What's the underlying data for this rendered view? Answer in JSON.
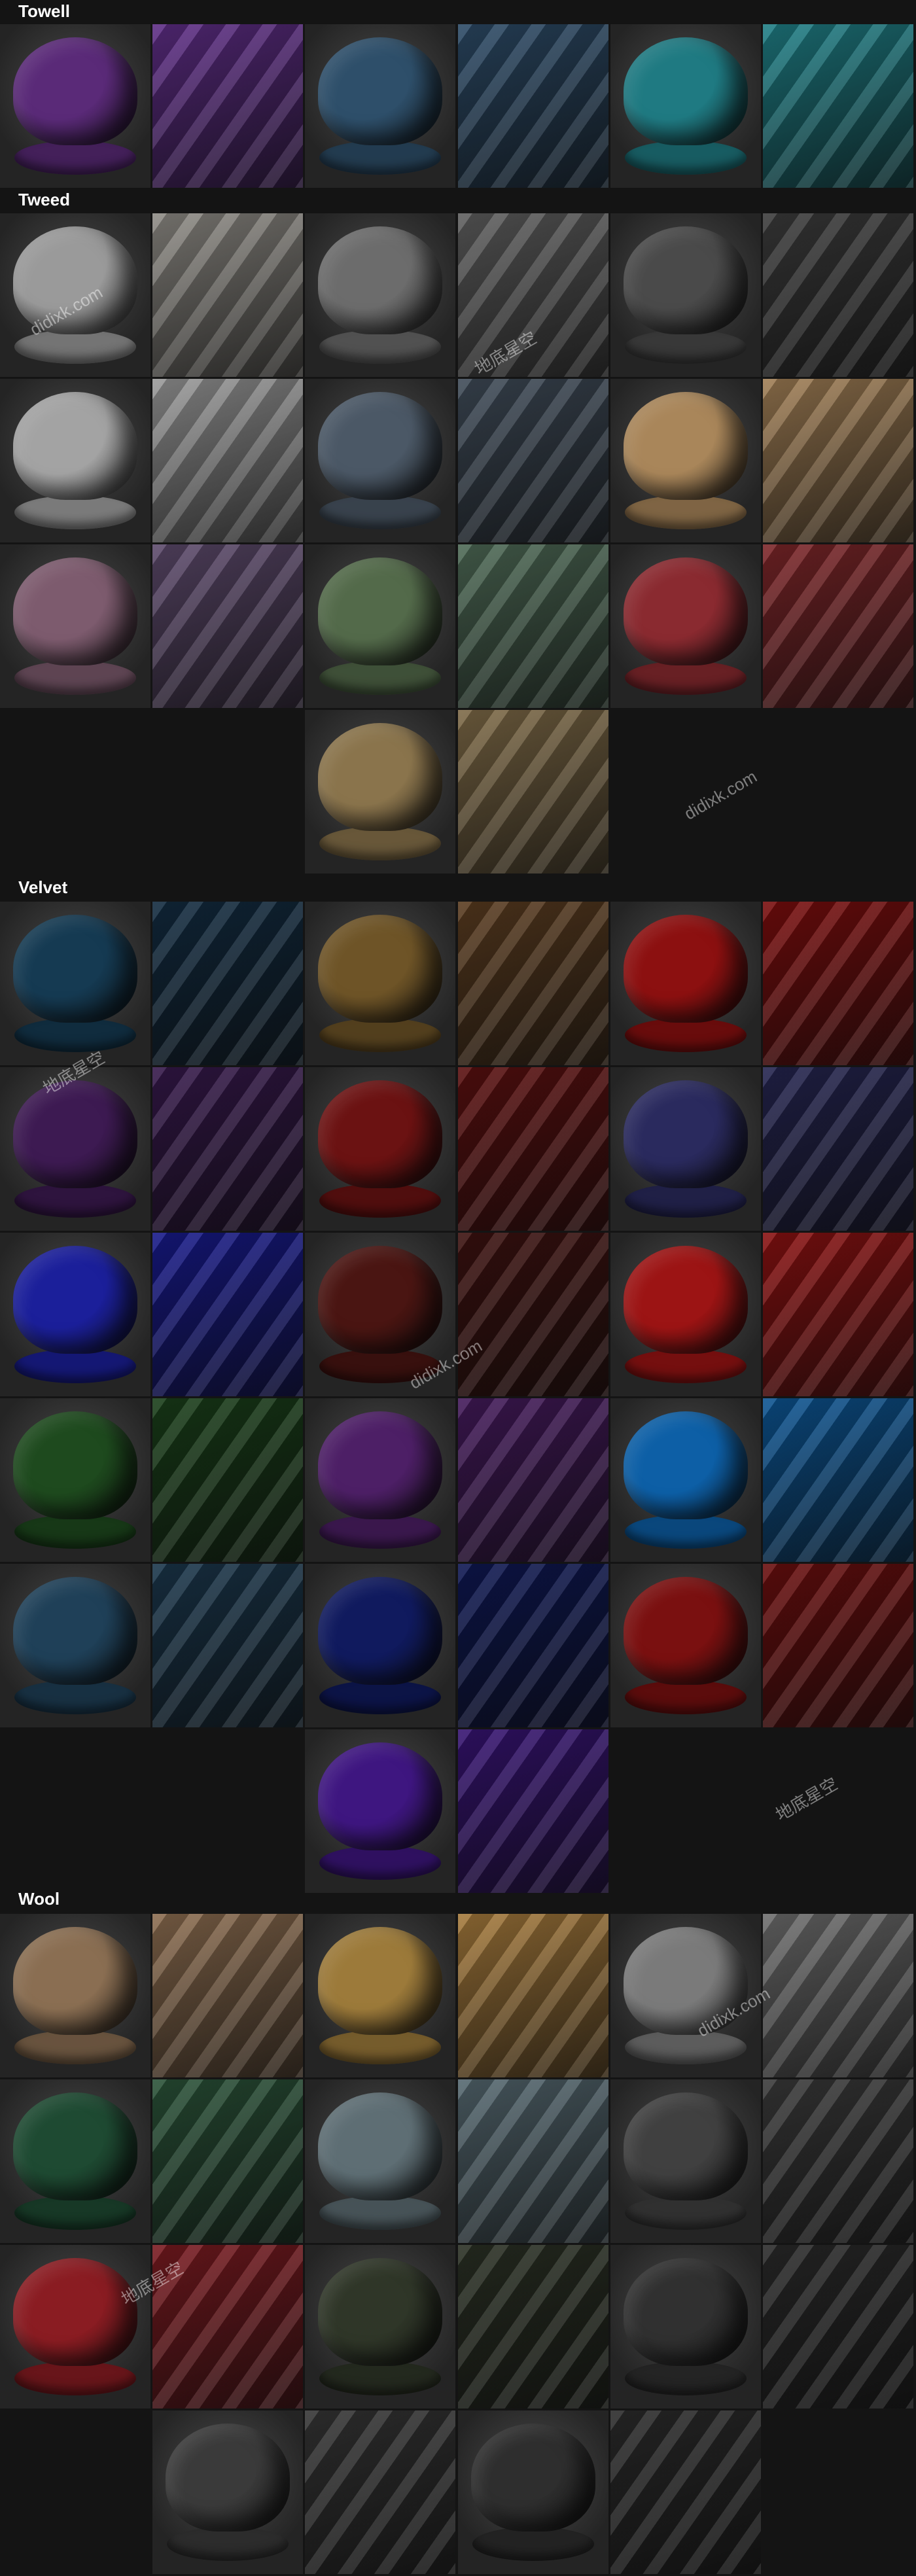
{
  "sections": [
    {
      "title": "Towell",
      "tiles": [
        {
          "kind": "sphere",
          "color": "#5a2a78"
        },
        {
          "kind": "swatch",
          "color": "#5e2d86"
        },
        {
          "kind": "sphere",
          "color": "#2e4f6a"
        },
        {
          "kind": "swatch",
          "color": "#2c4a66"
        },
        {
          "kind": "sphere",
          "color": "#1f7a82"
        },
        {
          "kind": "swatch",
          "color": "#1f7f86"
        }
      ]
    },
    {
      "title": "Tweed",
      "tiles": [
        {
          "kind": "sphere",
          "color": "#9a9a9a"
        },
        {
          "kind": "swatch",
          "color": "#8f8c86"
        },
        {
          "kind": "sphere",
          "color": "#6c6c6c"
        },
        {
          "kind": "swatch",
          "color": "#5f5f5f"
        },
        {
          "kind": "sphere",
          "color": "#4a4a4a"
        },
        {
          "kind": "swatch",
          "color": "#3c3c3c"
        },
        {
          "kind": "sphere",
          "color": "#a3a3a3"
        },
        {
          "kind": "swatch",
          "color": "#9a9a9a"
        },
        {
          "kind": "sphere",
          "color": "#4b5866"
        },
        {
          "kind": "swatch",
          "color": "#3f4b58"
        },
        {
          "kind": "sphere",
          "color": "#a9865a"
        },
        {
          "kind": "swatch",
          "color": "#a07e55"
        },
        {
          "kind": "sphere",
          "color": "#7d5b6e"
        },
        {
          "kind": "swatch",
          "color": "#5d4a6c"
        },
        {
          "kind": "sphere",
          "color": "#536a4a"
        },
        {
          "kind": "swatch",
          "color": "#4e6a56"
        },
        {
          "kind": "sphere",
          "color": "#8a2a30"
        },
        {
          "kind": "swatch",
          "color": "#7d2629"
        },
        {
          "kind": "sphere",
          "color": "#8a744c"
        },
        {
          "kind": "swatch",
          "color": "#7e6a47"
        }
      ]
    },
    {
      "title": "Velvet",
      "tiles": [
        {
          "kind": "sphere",
          "color": "#153a52"
        },
        {
          "kind": "swatch",
          "color": "#122b40"
        },
        {
          "kind": "sphere",
          "color": "#6e5427"
        },
        {
          "kind": "swatch",
          "color": "#5a3c20"
        },
        {
          "kind": "sphere",
          "color": "#8c1010"
        },
        {
          "kind": "swatch",
          "color": "#7a0d0d"
        },
        {
          "kind": "sphere",
          "color": "#3d1a52"
        },
        {
          "kind": "swatch",
          "color": "#35184a"
        },
        {
          "kind": "sphere",
          "color": "#6b1212"
        },
        {
          "kind": "swatch",
          "color": "#5a0f0f"
        },
        {
          "kind": "sphere",
          "color": "#2a2a5e"
        },
        {
          "kind": "swatch",
          "color": "#24244f"
        },
        {
          "kind": "sphere",
          "color": "#1b1f9a"
        },
        {
          "kind": "swatch",
          "color": "#17198a"
        },
        {
          "kind": "sphere",
          "color": "#4a1512"
        },
        {
          "kind": "swatch",
          "color": "#3c110f"
        },
        {
          "kind": "sphere",
          "color": "#9c1414"
        },
        {
          "kind": "swatch",
          "color": "#8a1111"
        },
        {
          "kind": "sphere",
          "color": "#1e4a1e"
        },
        {
          "kind": "swatch",
          "color": "#193e19"
        },
        {
          "kind": "sphere",
          "color": "#4d1f66"
        },
        {
          "kind": "swatch",
          "color": "#43195a"
        },
        {
          "kind": "sphere",
          "color": "#0d5fa6"
        },
        {
          "kind": "swatch",
          "color": "#0c5492"
        },
        {
          "kind": "sphere",
          "color": "#1f4058"
        },
        {
          "kind": "swatch",
          "color": "#1a364b"
        },
        {
          "kind": "sphere",
          "color": "#101a5e"
        },
        {
          "kind": "swatch",
          "color": "#0e1752"
        },
        {
          "kind": "sphere",
          "color": "#7a1010"
        },
        {
          "kind": "swatch",
          "color": "#6a0e0e"
        },
        {
          "kind": "sphere",
          "color": "#3e1680"
        },
        {
          "kind": "swatch",
          "color": "#361372"
        }
      ]
    },
    {
      "title": "Wool",
      "tiles": [
        {
          "kind": "sphere",
          "color": "#8a6e52"
        },
        {
          "kind": "swatch",
          "color": "#8c6d50"
        },
        {
          "kind": "sphere",
          "color": "#9c7a3a"
        },
        {
          "kind": "swatch",
          "color": "#a57a3c"
        },
        {
          "kind": "sphere",
          "color": "#7a7a7a"
        },
        {
          "kind": "swatch",
          "color": "#6e6e6e"
        },
        {
          "kind": "sphere",
          "color": "#1e4a32"
        },
        {
          "kind": "swatch",
          "color": "#2a5238"
        },
        {
          "kind": "sphere",
          "color": "#5e6e74"
        },
        {
          "kind": "swatch",
          "color": "#556870"
        },
        {
          "kind": "sphere",
          "color": "#404040"
        },
        {
          "kind": "swatch",
          "color": "#3a3a3a"
        },
        {
          "kind": "sphere",
          "color": "#8a1c22"
        },
        {
          "kind": "swatch",
          "color": "#7a1a20"
        },
        {
          "kind": "sphere",
          "color": "#2f3628"
        },
        {
          "kind": "swatch",
          "color": "#2a3024"
        },
        {
          "kind": "sphere",
          "color": "#303030"
        },
        {
          "kind": "swatch",
          "color": "#2a2a2a"
        },
        {
          "kind": "sphere",
          "color": "#3a3a3a"
        },
        {
          "kind": "swatch",
          "color": "#353535"
        },
        {
          "kind": "sphere",
          "color": "#2e2e2e"
        },
        {
          "kind": "swatch",
          "color": "#2b2b2b"
        }
      ]
    }
  ],
  "watermarks": [
    "didixk.com",
    "地底星空"
  ]
}
